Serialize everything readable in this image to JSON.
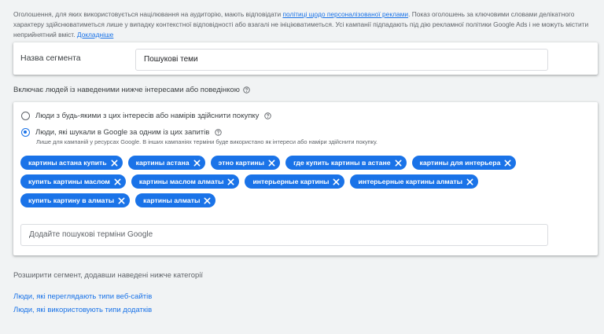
{
  "notice": {
    "text_before": "Оголошення, для яких використовується націлювання на аудиторію, мають відповідати ",
    "policy_link": "політиці щодо персоналізованої реклами",
    "text_after": ". Показ оголошень за ключовими словами делікатного характеру здійснюватиметься лише у випадку контекстної відповідності або взагалі не ініціюватиметься. Усі кампанії підпадають під дію рекламної політики Google Ads і не можуть містити неприйнятний вміст.",
    "more_link": "Докладніше"
  },
  "segment": {
    "label": "Назва сегмента",
    "value": "Пошукові теми"
  },
  "interests": {
    "heading": "Включає людей із наведеними нижче інтересами або поведінкою",
    "option1": "Люди з будь-якими з цих інтересів або намірів здійснити покупку",
    "option2": "Люди, які шукали в Google за одним із цих запитів",
    "option2_hint": "Лише для кампаній у ресурсах Google. В інших кампаніях терміни буде використано як інтереси або наміри здійснити покупку.",
    "selected_option": 2,
    "chips": [
      [
        "картины астана купить",
        "картины астана",
        "этно картины",
        "где купить картины в астане",
        "картины для интерьера"
      ],
      [
        "купить картины маслом",
        "картины маслом алматы",
        "интерьерные картины",
        "интерьерные картины алматы"
      ],
      [
        "купить картину в алматы",
        "картины алматы"
      ]
    ],
    "terms_placeholder": "Додайте пошукові терміни Google"
  },
  "expand": {
    "text": "Розширити сегмент, додавши наведені нижче категорії",
    "link1": "Люди, які переглядають типи веб-сайтів",
    "link2": "Люди, які використовують типи додатків"
  },
  "colors": {
    "accent": "#1a73e8",
    "background": "#f1f3f4"
  },
  "icons": {
    "help": "help-circle-icon",
    "chip_remove": "close-icon"
  }
}
